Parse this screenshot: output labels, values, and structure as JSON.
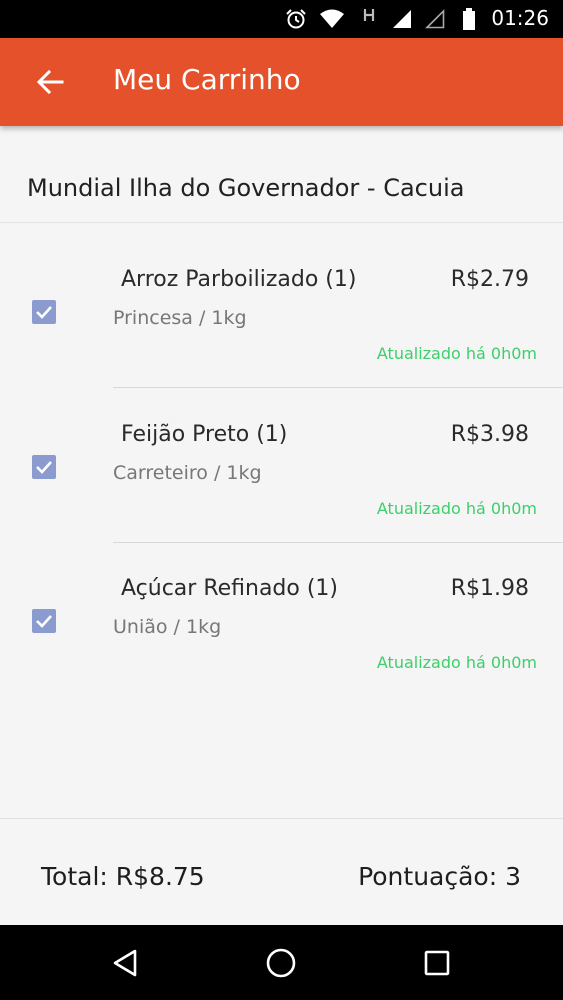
{
  "status_bar": {
    "time": "01:26",
    "icons": [
      "alarm-icon",
      "wifi-icon",
      "network-h-icon",
      "signal-icon",
      "signal-empty-icon",
      "battery-icon"
    ]
  },
  "app_bar": {
    "title": "Meu Carrinho",
    "back_icon": "arrow-left-icon",
    "color": "#e5512a"
  },
  "store": {
    "name": "Mundial Ilha do Governador - Cacuia"
  },
  "items": [
    {
      "name": "Arroz Parboilizado (1)",
      "price": "R$2.79",
      "detail": "Princesa / 1kg",
      "updated": "Atualizado há 0h0m",
      "checked": true
    },
    {
      "name": "Feijão Preto (1)",
      "price": "R$3.98",
      "detail": "Carreteiro / 1kg",
      "updated": "Atualizado há 0h0m",
      "checked": true
    },
    {
      "name": "Açúcar Refinado (1)",
      "price": "R$1.98",
      "detail": "União / 1kg",
      "updated": "Atualizado há 0h0m",
      "checked": true
    }
  ],
  "footer": {
    "total": "Total: R$8.75",
    "score": "Pontuação: 3"
  },
  "nav_bar": {
    "buttons": [
      "back-triangle-icon",
      "home-circle-icon",
      "recents-square-icon"
    ]
  },
  "colors": {
    "accent": "#e5512a",
    "checkbox": "#8b9bd0",
    "updated_text": "#3ccf6a"
  }
}
